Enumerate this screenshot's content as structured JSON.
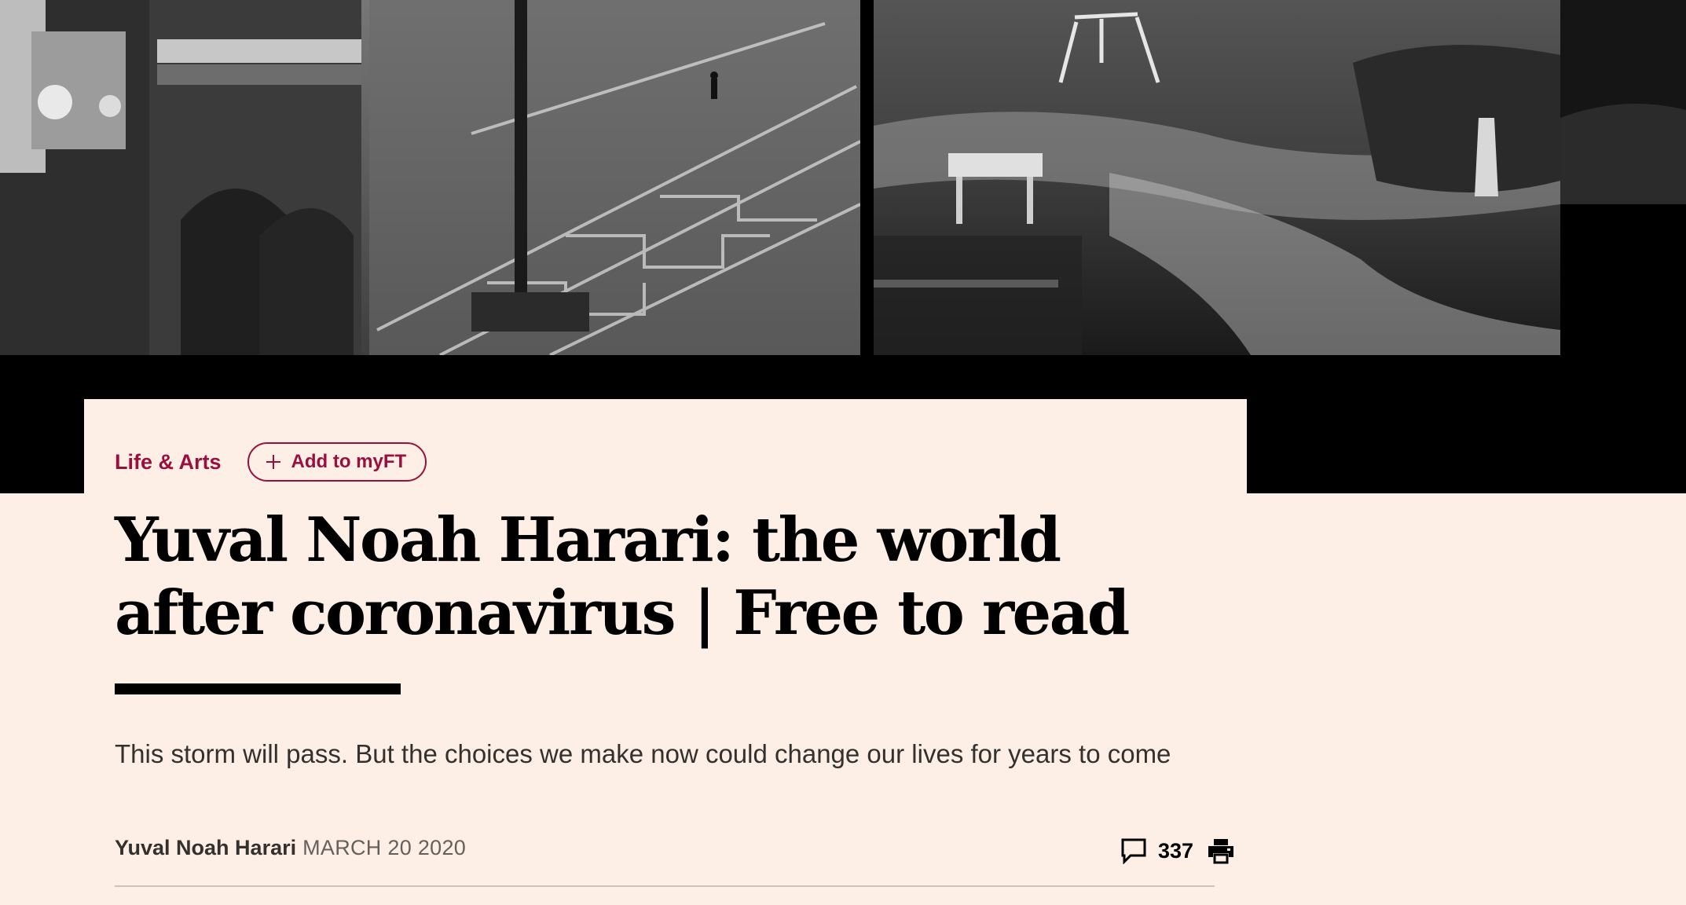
{
  "article": {
    "section": "Life & Arts",
    "myft_button_label": "Add to myFT",
    "headline": "Yuval Noah Harari: the world after coronavirus | Free to read",
    "standfirst": "This storm will pass. But the choices we make now could change our lives for years to come",
    "byline": {
      "author": "Yuval Noah Harari",
      "date": "MARCH 20 2020"
    },
    "tools": {
      "comment_count": "337",
      "comment_icon": "speech-bubble-icon",
      "print_icon": "printer-icon"
    }
  },
  "hero": {
    "panels": [
      "empty-piazza-photo",
      "empty-playground-photo"
    ]
  },
  "colors": {
    "page_background": "#fdefe6",
    "hero_background": "#000000",
    "accent_claret": "#990f3d",
    "text_dark": "#33302e",
    "text_muted": "#66605c"
  }
}
